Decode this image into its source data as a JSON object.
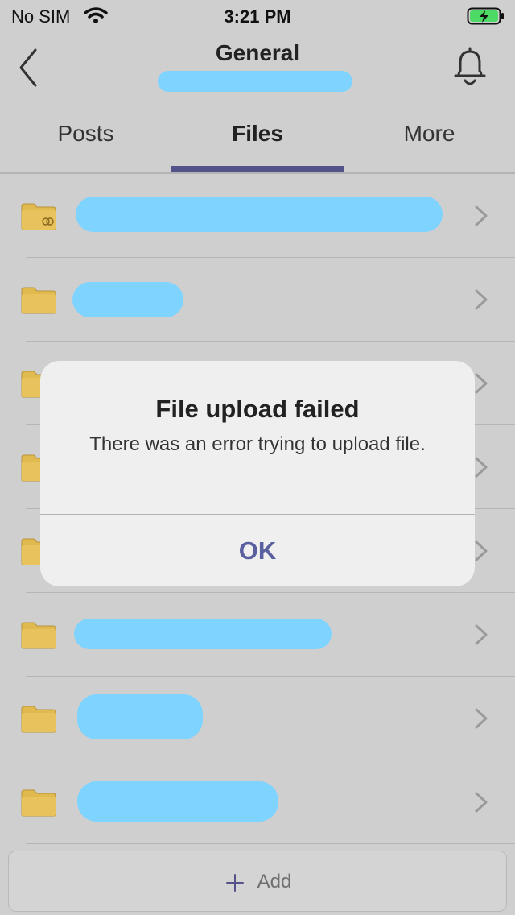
{
  "status_bar": {
    "carrier": "No SIM",
    "time": "3:21 PM"
  },
  "nav": {
    "title": "General"
  },
  "tabs": [
    {
      "label": "Posts"
    },
    {
      "label": "Files"
    },
    {
      "label": "More"
    }
  ],
  "files": [
    {
      "name": ""
    },
    {
      "name": ""
    },
    {
      "name": ""
    },
    {
      "name": ""
    },
    {
      "name": ""
    },
    {
      "name": ""
    },
    {
      "name": ""
    },
    {
      "name": ""
    }
  ],
  "add": {
    "label": "Add"
  },
  "alert": {
    "title": "File upload failed",
    "message": "There was an error trying to upload file.",
    "ok_label": "OK"
  },
  "colors": {
    "accent": "#53538a",
    "folder": "#e0b94f",
    "ok": "#5a5fa0"
  }
}
